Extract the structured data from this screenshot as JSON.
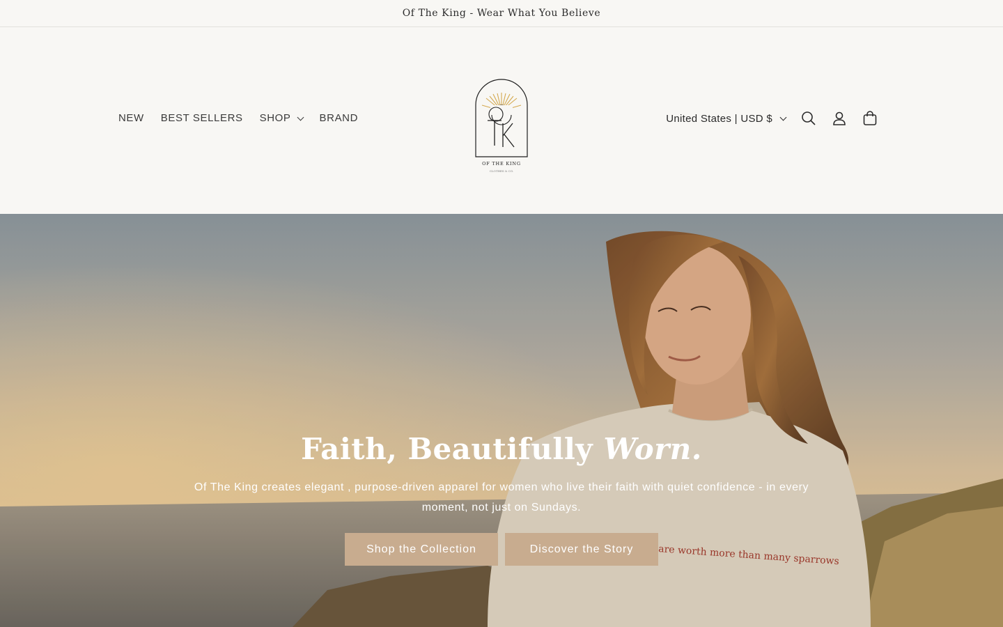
{
  "announcement": {
    "text": "Of The King - Wear What You Believe"
  },
  "nav": {
    "items": [
      {
        "label": "NEW"
      },
      {
        "label": "BEST SELLERS"
      },
      {
        "label": "SHOP"
      },
      {
        "label": "BRAND"
      }
    ]
  },
  "logo": {
    "letters": "TK",
    "tagline": "OF THE KING",
    "small_text": "CLOTHES & CO."
  },
  "utilities": {
    "locale": "United States | USD $",
    "icons": [
      "search-icon",
      "account-icon",
      "cart-icon"
    ]
  },
  "hero": {
    "title_main": "Faith, Beautifully ",
    "title_em": "Worn.",
    "subtitle": "Of The King creates elegant , purpose-driven apparel for women who live their faith with quiet confidence - in every moment, not just on Sundays.",
    "buttons": {
      "primary": "Shop the Collection",
      "secondary": "Discover the Story"
    },
    "shirt_text": "are worth more than many sparrows"
  },
  "colors": {
    "background": "#f8f7f4",
    "button": "#c8ac8f",
    "logo_sun": "#d4a94f"
  }
}
